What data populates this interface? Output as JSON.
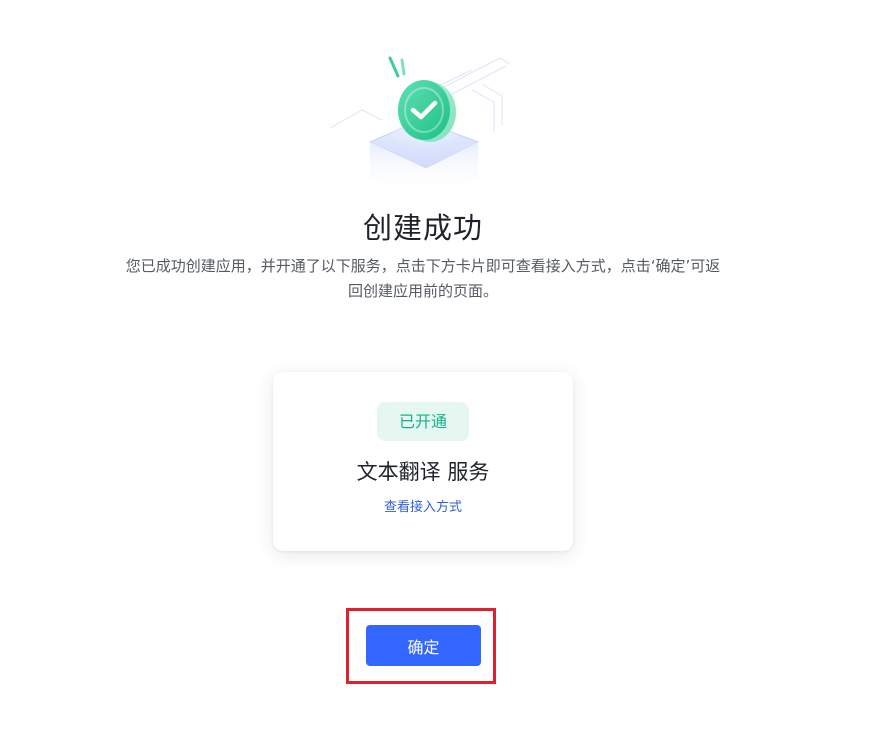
{
  "result": {
    "title": "创建成功",
    "description": "您已成功创建应用，并开通了以下服务，点击下方卡片即可查看接入方式，点击‘确定’可返回创建应用前的页面。",
    "icon": "success-check-icon"
  },
  "service_card": {
    "status_badge": "已开通",
    "name": "文本翻译 服务",
    "link_label": "查看接入方式"
  },
  "actions": {
    "confirm_label": "确定"
  },
  "colors": {
    "primary": "#3366ff",
    "success": "#14b38a",
    "success_bg": "#e6f7f2",
    "link": "#2f5fd9",
    "highlight_border": "#e0202e"
  }
}
